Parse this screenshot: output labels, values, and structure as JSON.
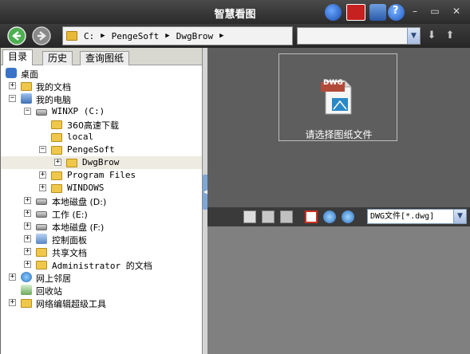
{
  "window": {
    "title": "智慧看图"
  },
  "address": {
    "segments": [
      "C:",
      "PengeSoft",
      "DwgBrow"
    ]
  },
  "search": {
    "value": ""
  },
  "tabs": [
    {
      "label": "目录",
      "active": true
    },
    {
      "label": "历史",
      "active": false
    },
    {
      "label": "查询图纸",
      "active": false
    }
  ],
  "tree": [
    {
      "label": "桌面"
    },
    {
      "label": "我的文档"
    },
    {
      "label": "我的电脑"
    },
    {
      "label": "WINXP (C:)"
    },
    {
      "label": "360高速下载"
    },
    {
      "label": "local"
    },
    {
      "label": "PengeSoft"
    },
    {
      "label": "DwgBrow",
      "selected": true
    },
    {
      "label": "Program Files"
    },
    {
      "label": "WINDOWS"
    },
    {
      "label": "本地磁盘 (D:)"
    },
    {
      "label": "工作 (E:)"
    },
    {
      "label": "本地磁盘 (F:)"
    },
    {
      "label": "控制面板"
    },
    {
      "label": "共享文档"
    },
    {
      "label": "Administrator 的文档"
    },
    {
      "label": "网上邻居"
    },
    {
      "label": "回收站"
    },
    {
      "label": "网络编辑超级工具"
    }
  ],
  "preview": {
    "icon_badge": "DWG",
    "label": "请选择图纸文件"
  },
  "filter": {
    "selected": "DWG文件[*.dwg]"
  },
  "colors": {
    "accent": "#7ea7d6",
    "title_bg": "#2a2a2a",
    "folder": "#efc74a"
  }
}
